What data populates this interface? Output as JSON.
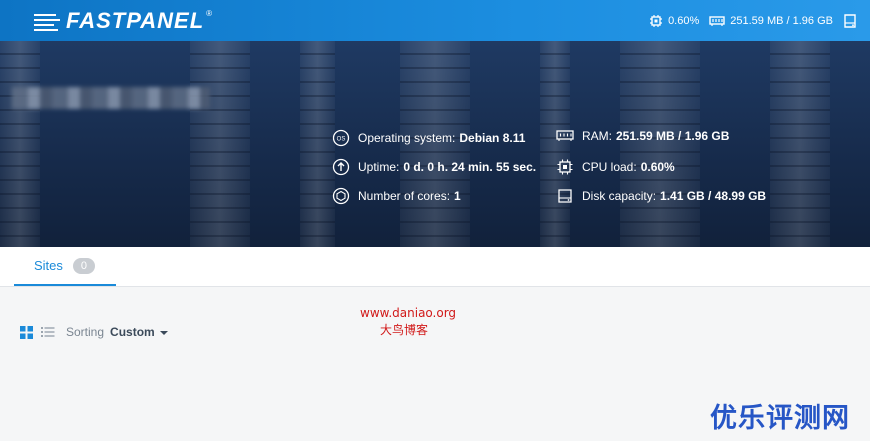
{
  "topbar": {
    "brand": "FASTPANEL",
    "brand_mark": "®",
    "cpu_value": "0.60%",
    "ram_value": "251.59 MB / 1.96 GB"
  },
  "server": {
    "name_redacted": true,
    "os_label": "Operating system:",
    "os_value": "Debian 8.11",
    "uptime_label": "Uptime:",
    "uptime_value": "0 d. 0 h. 24 min. 55 sec.",
    "cores_label": "Number of cores:",
    "cores_value": "1",
    "ram_label": "RAM:",
    "ram_value": "251.59 MB / 1.96 GB",
    "cpu_label": "CPU load:",
    "cpu_value": "0.60%",
    "disk_label": "Disk capacity:",
    "disk_value": "1.41 GB / 48.99 GB"
  },
  "tabs": [
    {
      "label": "Sites",
      "count": "0"
    }
  ],
  "toolbar": {
    "sort_label": "Sorting",
    "sort_value": "Custom"
  },
  "watermarks": {
    "url": "www.daniao.org",
    "blog": "大鸟博客",
    "brand": "优乐评测网"
  },
  "colors": {
    "accent": "#1a8ad9",
    "topbar": "#1c8ee0",
    "hero": "#1f3a63"
  }
}
